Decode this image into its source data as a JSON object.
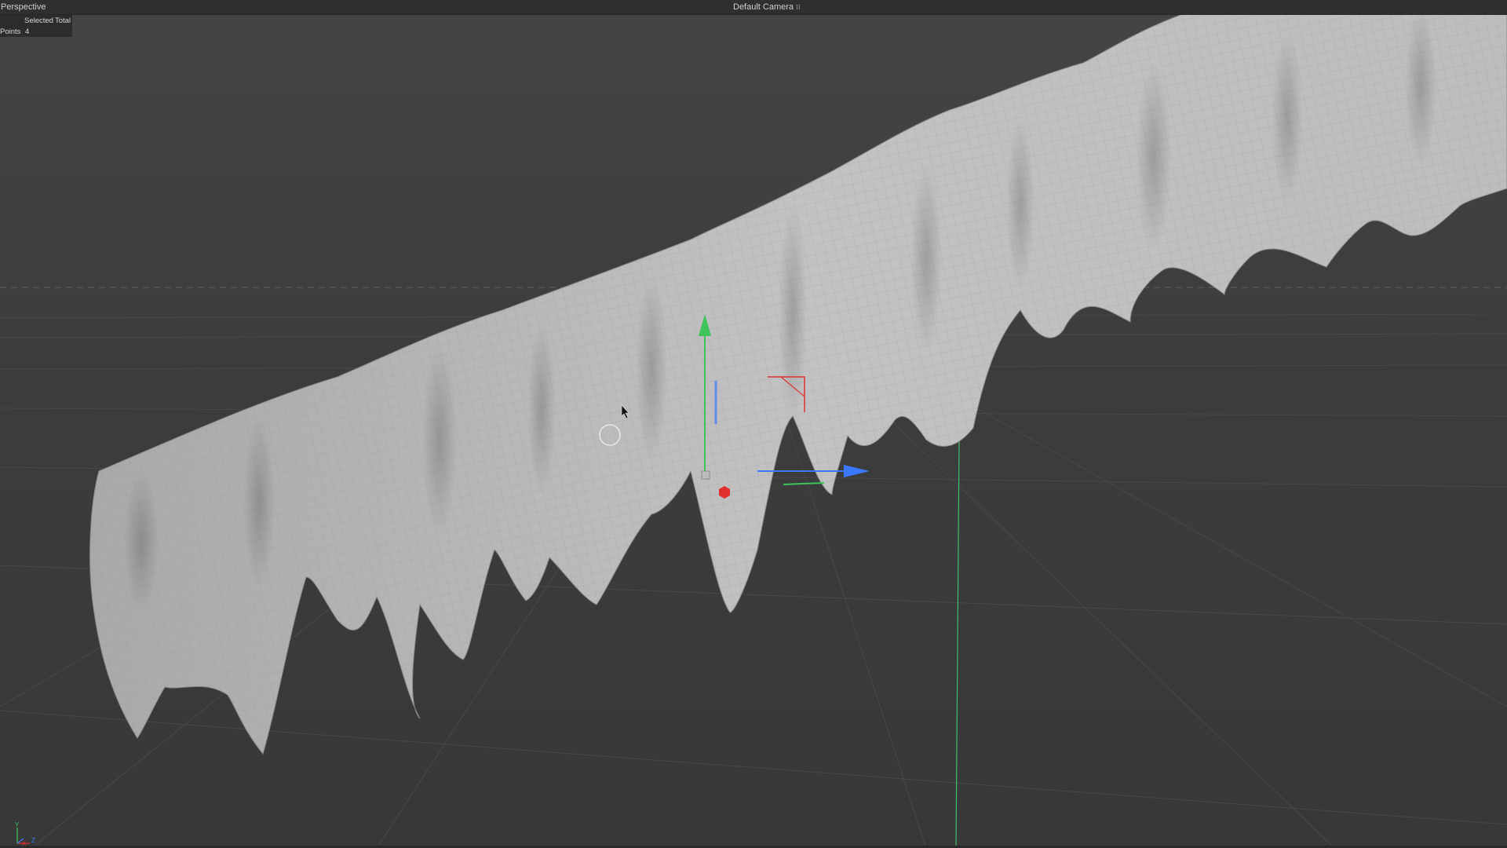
{
  "viewport": {
    "mode_label": "Perspective",
    "camera_label": "Default Camera",
    "camera_icon": "camera-options-icon"
  },
  "hud": {
    "col_selected": "Selected",
    "col_total": "Total",
    "row_label": "Points",
    "row_selected": "4",
    "row_total": ""
  },
  "axis_indicator": {
    "y": "Y",
    "x": "X",
    "z": "Z"
  },
  "colors": {
    "background": "#3b3b3b",
    "mesh": "#b9b9b9",
    "wire": "#7a84a8",
    "gizmo_x": "#e0312e",
    "gizmo_y": "#3ec45a",
    "gizmo_z": "#3a78ff"
  }
}
